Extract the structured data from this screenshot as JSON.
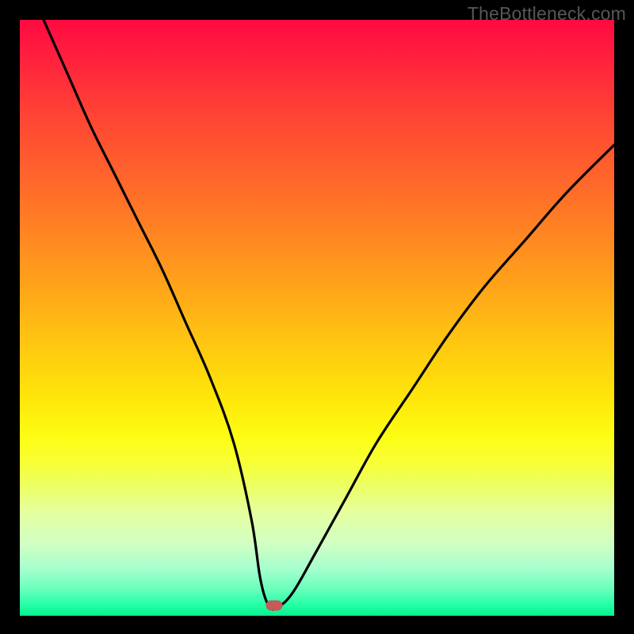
{
  "watermark": "TheBottleneck.com",
  "colors": {
    "frame": "#000000",
    "curve": "#000000",
    "marker": "#c65a59",
    "watermark": "#575757"
  },
  "chart_data": {
    "type": "line",
    "title": "",
    "xlabel": "",
    "ylabel": "",
    "xlim": [
      0,
      100
    ],
    "ylim": [
      0,
      100
    ],
    "note": "Axes are not labeled in the image; x and y are normalized 0–100. y=100 is the top (red/high bottleneck), y≈0 is the bottom (green/optimal). The curve is a V-shaped bottleneck profile with its minimum near x≈42.",
    "series": [
      {
        "name": "bottleneck-curve",
        "x": [
          4,
          8,
          12,
          16,
          20,
          24,
          28,
          32,
          36,
          39,
          40.5,
          42,
          43.5,
          46,
          50,
          55,
          60,
          66,
          72,
          78,
          85,
          92,
          100
        ],
        "y": [
          100,
          91,
          82,
          74,
          66,
          58,
          49,
          40,
          29,
          16,
          6,
          1.5,
          1.5,
          4,
          11,
          20,
          29,
          38,
          47,
          55,
          63,
          71,
          79
        ]
      }
    ],
    "marker": {
      "x_pct": 42.8,
      "y_from_bottom_pct": 1.7
    },
    "gradient_stops": [
      {
        "pct": 0,
        "color": "#ff0a41"
      },
      {
        "pct": 28,
        "color": "#ff6a2a"
      },
      {
        "pct": 55,
        "color": "#ffc910"
      },
      {
        "pct": 74,
        "color": "#f9ff33"
      },
      {
        "pct": 92,
        "color": "#a7ffce"
      },
      {
        "pct": 100,
        "color": "#05f28e"
      }
    ]
  }
}
